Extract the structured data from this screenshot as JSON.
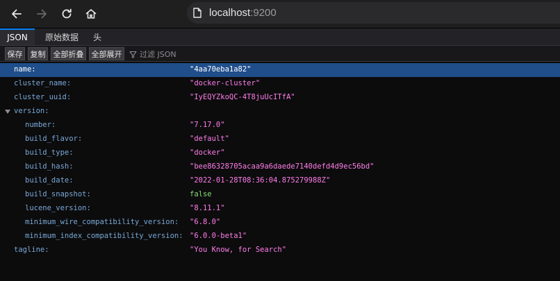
{
  "browser": {
    "url_host": "localhost",
    "url_port": ":9200",
    "back_icon": "arrow-left-icon",
    "forward_icon": "arrow-right-icon",
    "reload_icon": "reload-icon",
    "home_icon": "home-icon"
  },
  "viewer": {
    "tabs": [
      {
        "label": "JSON",
        "active": true
      },
      {
        "label": "原始数据",
        "active": false
      },
      {
        "label": "头",
        "active": false
      }
    ],
    "actions": {
      "save": "保存",
      "copy": "复制",
      "collapse_all": "全部折叠",
      "expand_all": "全部展开"
    },
    "filter_placeholder": "过滤 JSON"
  },
  "json": {
    "name": {
      "key": "name:",
      "value": "\"4aa70eba1a82\""
    },
    "cluster_name": {
      "key": "cluster_name:",
      "value": "\"docker-cluster\""
    },
    "cluster_uuid": {
      "key": "cluster_uuid:",
      "value": "\"IyEQYZkoQC-4T8juUcITfA\""
    },
    "version": {
      "key": "version:"
    },
    "number": {
      "key": "number:",
      "value": "\"7.17.0\""
    },
    "build_flavor": {
      "key": "build_flavor:",
      "value": "\"default\""
    },
    "build_type": {
      "key": "build_type:",
      "value": "\"docker\""
    },
    "build_hash": {
      "key": "build_hash:",
      "value": "\"bee86328705acaa9a6daede7140defd4d9ec56bd\""
    },
    "build_date": {
      "key": "build_date:",
      "value": "\"2022-01-28T08:36:04.875279988Z\""
    },
    "build_snapshot": {
      "key": "build_snapshot:",
      "value": "false"
    },
    "lucene_version": {
      "key": "lucene_version:",
      "value": "\"8.11.1\""
    },
    "minimum_wire_compatibility_version": {
      "key": "minimum_wire_compatibility_version:",
      "value": "\"6.8.0\""
    },
    "minimum_index_compatibility_version": {
      "key": "minimum_index_compatibility_version:",
      "value": "\"6.0.0-beta1\""
    },
    "tagline": {
      "key": "tagline:",
      "value": "\"You Know, for Search\""
    }
  },
  "colors": {
    "selected_row": "#204e8a",
    "key": "#7aa8d6",
    "string": "#ff7de9",
    "boolean": "#86de74",
    "active_tab_accent": "#0a84ff"
  }
}
